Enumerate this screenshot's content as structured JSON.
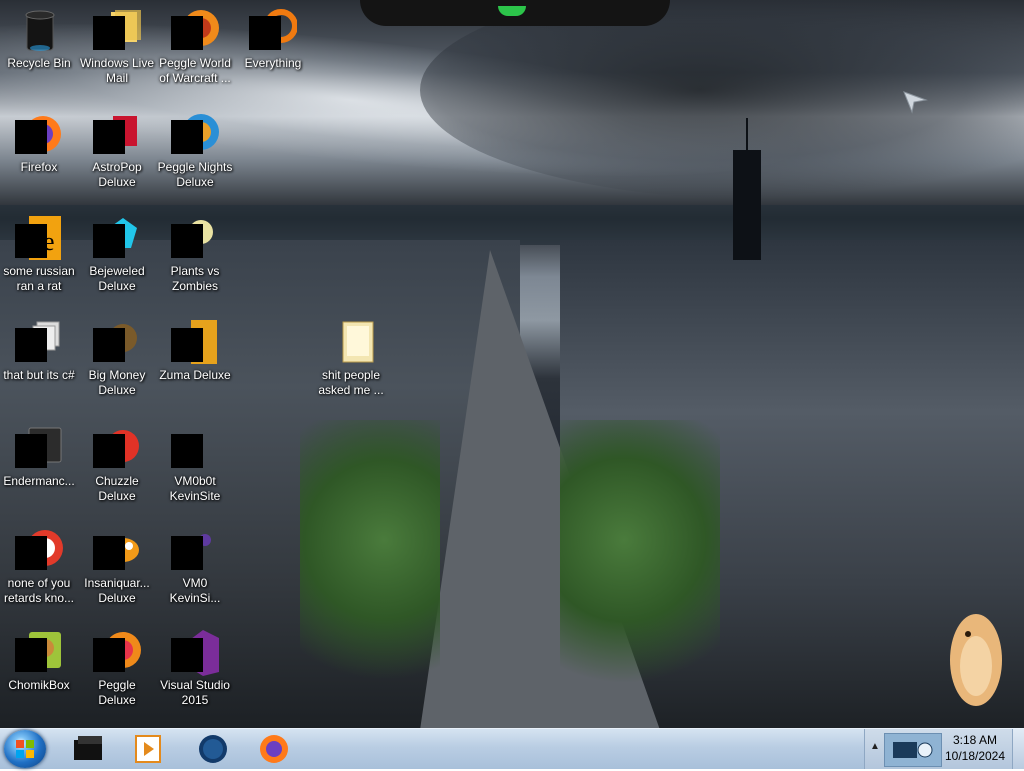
{
  "desktop": {
    "icons": [
      {
        "label": "Recycle Bin",
        "icon": "recycle-bin-icon"
      },
      {
        "label": "Windows Live Mail",
        "icon": "windows-live-mail-icon"
      },
      {
        "label": "Peggle World of Warcraft ...",
        "icon": "peggle-wow-icon"
      },
      {
        "label": "Everything",
        "icon": "everything-search-icon"
      },
      {
        "label": "Firefox",
        "icon": "firefox-icon"
      },
      {
        "label": "AstroPop Deluxe",
        "icon": "astropop-icon"
      },
      {
        "label": "Peggle Nights Deluxe",
        "icon": "peggle-nights-icon"
      },
      {
        "label": "some russian ran a rat",
        "icon": "file-icon"
      },
      {
        "label": "Bejeweled Deluxe",
        "icon": "bejeweled-icon"
      },
      {
        "label": "Plants vs Zombies",
        "icon": "plants-vs-zombies-icon"
      },
      {
        "label": "that but its c#",
        "icon": "file-stack-icon"
      },
      {
        "label": "Big Money Deluxe",
        "icon": "big-money-icon"
      },
      {
        "label": "Zuma Deluxe",
        "icon": "zuma-icon"
      },
      {
        "label": "shit people asked me ...",
        "icon": "folder-icon"
      },
      {
        "label": "Endermanc...",
        "icon": "app-window-icon"
      },
      {
        "label": "Chuzzle Deluxe",
        "icon": "chuzzle-icon"
      },
      {
        "label": "VM0b0t KevinSite",
        "icon": "shortcut-icon"
      },
      {
        "label": "none of you retards kno...",
        "icon": "file-red-icon"
      },
      {
        "label": "Insaniquar... Deluxe",
        "icon": "insaniquarium-icon"
      },
      {
        "label": "VM0 KevinSi...",
        "icon": "shortcut-icon"
      },
      {
        "label": "ChomikBox",
        "icon": "chomikbox-icon"
      },
      {
        "label": "Peggle Deluxe",
        "icon": "peggle-icon"
      },
      {
        "label": "Visual Studio 2015",
        "icon": "visual-studio-icon"
      }
    ]
  },
  "taskbar": {
    "pinned": [
      {
        "name": "black-box-app",
        "icon": "black-box-icon"
      },
      {
        "name": "media-player",
        "icon": "media-player-icon"
      },
      {
        "name": "globe-app",
        "icon": "globe-icon"
      },
      {
        "name": "firefox",
        "icon": "firefox-icon"
      }
    ],
    "clock": {
      "time": "3:18 AM",
      "date": "10/18/2024"
    }
  },
  "colors": {
    "taskbar": "#b9cde3",
    "label_text": "#ffffff",
    "start_orb": "#1f6fc4"
  }
}
